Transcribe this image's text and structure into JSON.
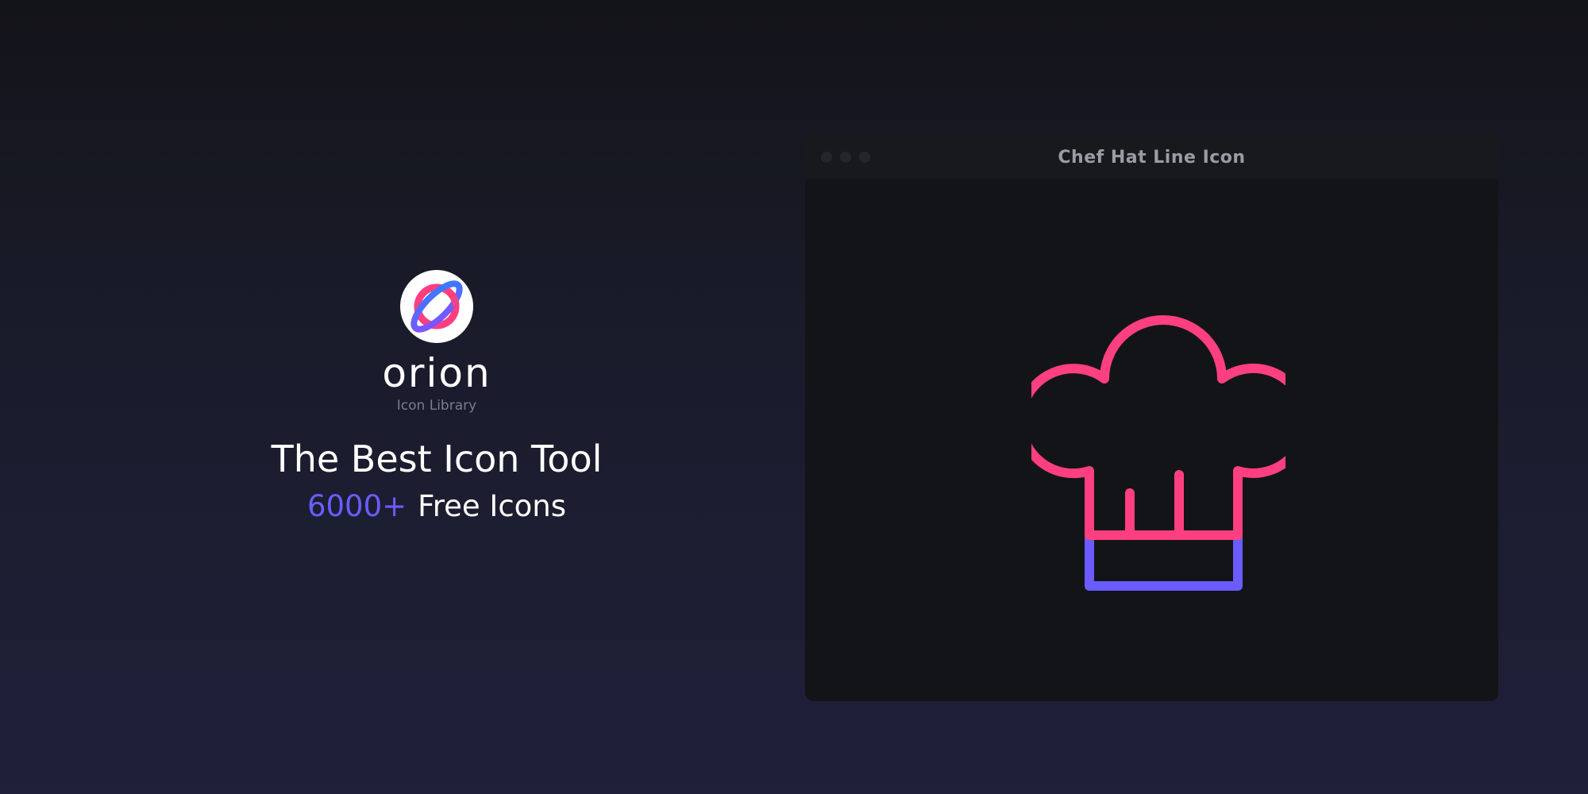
{
  "brand": {
    "name": "orion",
    "subtitle": "Icon Library",
    "logo_icon": "orion-planet-logo",
    "colors": {
      "pink": "#ff3f7f",
      "blue": "#3a7bff",
      "purple": "#6a5cff"
    }
  },
  "hero": {
    "headline": "The Best Icon Tool",
    "count": "6000+",
    "count_suffix": "Free Icons"
  },
  "window": {
    "title": "Chef Hat Line Icon",
    "controls": [
      "close",
      "minimize",
      "maximize"
    ],
    "icon": {
      "name": "chef-hat-icon",
      "primary_color": "#ff3f7f",
      "secondary_color": "#6a5cff"
    }
  }
}
